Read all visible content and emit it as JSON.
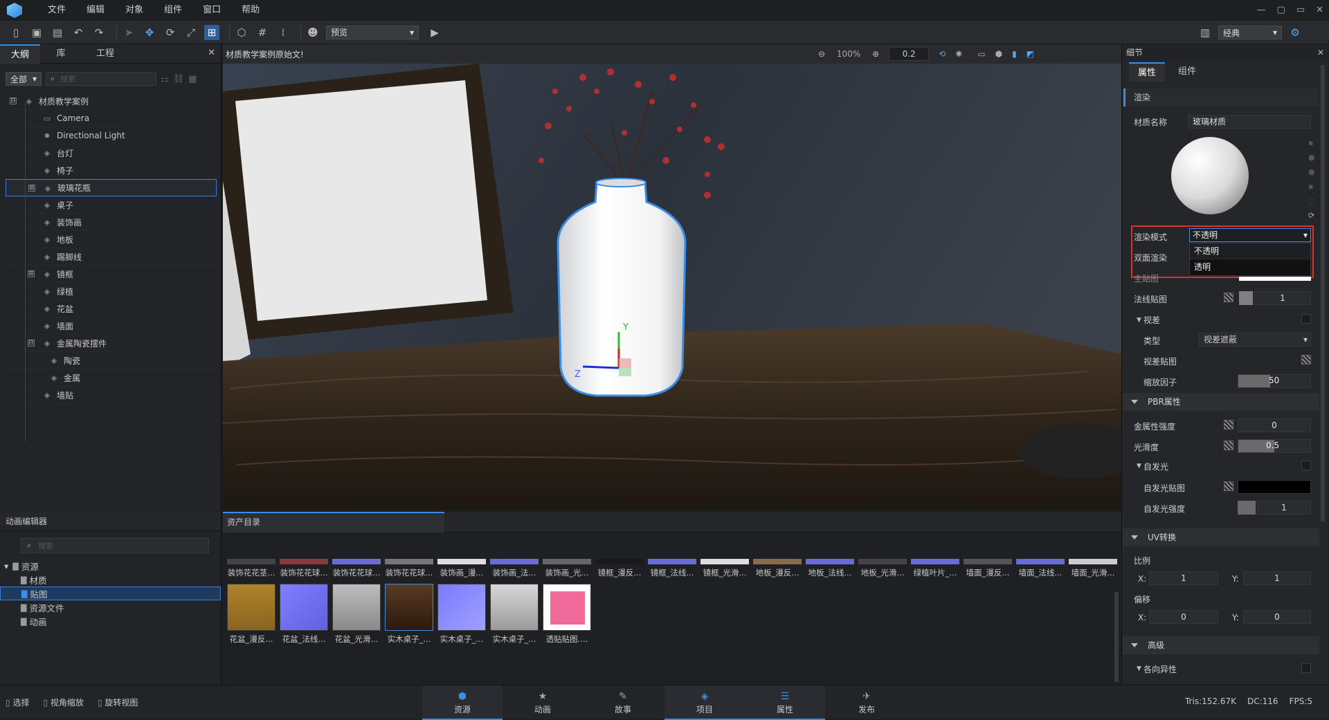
{
  "menubar": {
    "items": [
      "文件",
      "编辑",
      "对象",
      "组件",
      "窗口",
      "帮助"
    ],
    "window_controls": [
      "—",
      "▢",
      "▭",
      "✕"
    ]
  },
  "toolbar": {
    "preview_label": "预览",
    "layout_label": "经典"
  },
  "outline": {
    "tabs": [
      "大纲",
      "库",
      "工程"
    ],
    "filter_label": "全部",
    "search_placeholder": "搜索",
    "items": [
      {
        "label": "材质教学案例",
        "depth": 0
      },
      {
        "label": "Camera",
        "depth": 1
      },
      {
        "label": "Directional Light",
        "depth": 1
      },
      {
        "label": "台灯",
        "depth": 1
      },
      {
        "label": "椅子",
        "depth": 1
      },
      {
        "label": "玻璃花瓶",
        "depth": 1
      },
      {
        "label": "桌子",
        "depth": 1
      },
      {
        "label": "装饰画",
        "depth": 1
      },
      {
        "label": "地板",
        "depth": 1
      },
      {
        "label": "踢脚线",
        "depth": 1
      },
      {
        "label": "镜框",
        "depth": 1
      },
      {
        "label": "绿植",
        "depth": 1
      },
      {
        "label": "花盆",
        "depth": 1
      },
      {
        "label": "墙面",
        "depth": 1
      },
      {
        "label": "金属陶瓷摆件",
        "depth": 1
      },
      {
        "label": "陶瓷",
        "depth": 2
      },
      {
        "label": "金属",
        "depth": 2
      },
      {
        "label": "墙贴",
        "depth": 1
      }
    ]
  },
  "viewport": {
    "title": "材质教学案例原始文!",
    "zoom": "100%",
    "step": "0.2",
    "gizmo_y": "Y",
    "gizmo_z": "Z"
  },
  "details": {
    "title": "细节",
    "tabs": [
      "属性",
      "组件"
    ],
    "render_section": "渲染",
    "material_name_label": "材质名称",
    "material_name": "玻璃材质",
    "render_mode_label": "渲染模式",
    "render_mode_value": "不透明",
    "render_mode_options": [
      "不透明",
      "透明"
    ],
    "double_sided_label": "双面渲染",
    "main_map_label": "主贴图",
    "normal_map_label": "法线贴图",
    "normal_value": "1",
    "parallax_label": "视差",
    "type_label": "类型",
    "type_value": "视差遮蔽",
    "parallax_map_label": "视差贴图",
    "scale_factor_label": "缩放因子",
    "scale_factor_value": "50",
    "pbr_section": "PBR属性",
    "metal_label": "金属性强度",
    "metal_value": "0",
    "smooth_label": "光滑度",
    "smooth_value": "0.5",
    "emission_label": "自发光",
    "emission_map_label": "自发光贴图",
    "emission_strength_label": "自发光强度",
    "emission_strength_value": "1",
    "uv_section": "UV转换",
    "scale_label": "比例",
    "scale_x": "1",
    "scale_y": "1",
    "offset_label": "偏移",
    "offset_x": "0",
    "offset_y": "0",
    "x_label": "X:",
    "y_label": "Y:",
    "advanced_section": "高级",
    "anisotropy_label": "各向异性"
  },
  "anim_editor": {
    "title": "动画编辑器",
    "search_placeholder": "搜索"
  },
  "asset_tree": {
    "items": [
      {
        "label": "资源",
        "depth": 0
      },
      {
        "label": "材质",
        "depth": 1
      },
      {
        "label": "贴图",
        "depth": 1
      },
      {
        "label": "资源文件",
        "depth": 1
      },
      {
        "label": "动画",
        "depth": 1
      }
    ]
  },
  "asset_catalog": {
    "title": "资产目录",
    "row1": [
      "装饰花花茎...",
      "装饰花花球...",
      "装饰花花球...",
      "装饰花花球...",
      "装饰画_漫...",
      "装饰画_法...",
      "装饰画_光...",
      "镜框_漫反...",
      "镜框_法线...",
      "镜框_光滑...",
      "地板_漫反...",
      "地板_法线...",
      "地板_光滑...",
      "绿植叶片_...",
      "墙面_漫反...",
      "墙面_法线...",
      "墙面_光滑..."
    ],
    "row2": [
      "花盆_漫反...",
      "花盆_法线...",
      "花盆_光滑...",
      "实木桌子_...",
      "实木桌子_...",
      "实木桌子_...",
      "透贴贴图...."
    ]
  },
  "status": {
    "tools": [
      "选择",
      "视角缩放",
      "旋转视图"
    ],
    "tris": "Tris:152.67K",
    "dc": "DC:116",
    "fps": "FPS:5"
  },
  "bottom_nav": [
    "资源",
    "动画",
    "故事",
    "项目",
    "属性",
    "发布"
  ]
}
